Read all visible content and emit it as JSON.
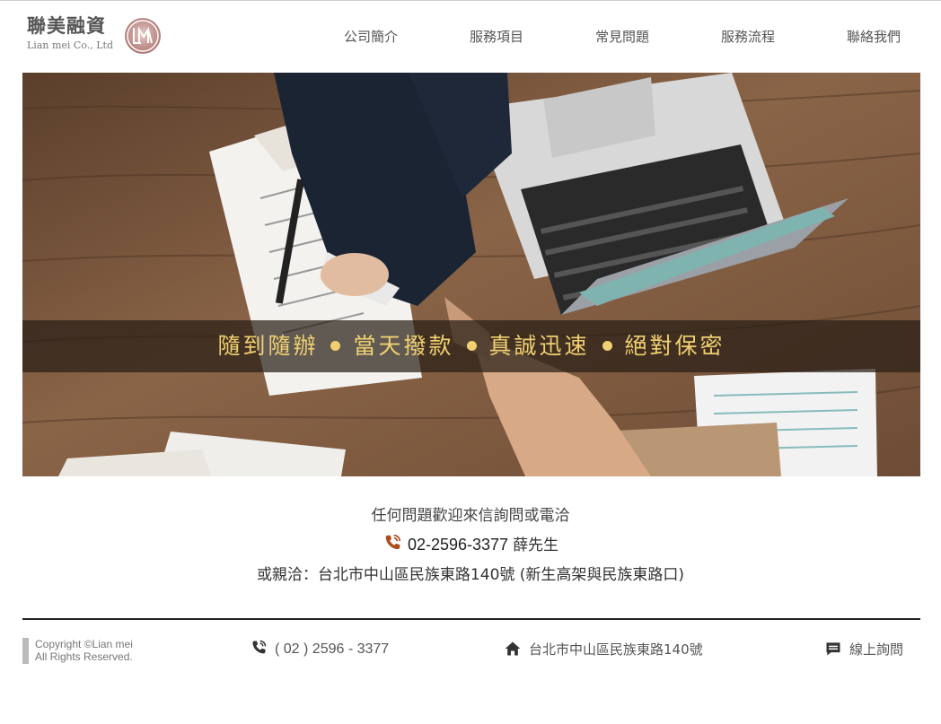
{
  "brand": {
    "name_cn": "聯美融資",
    "name_en": "Lian mei Co., Ltd"
  },
  "nav": {
    "items": [
      {
        "label": "公司簡介"
      },
      {
        "label": "服務項目"
      },
      {
        "label": "常見問題"
      },
      {
        "label": "服務流程"
      },
      {
        "label": "聯絡我們"
      }
    ]
  },
  "hero": {
    "slogans": [
      "隨到隨辦",
      "當天撥款",
      "真誠迅速",
      "絕對保密"
    ],
    "accent_color": "#f0d070"
  },
  "contact": {
    "intro": "任何問題歡迎來信詢問或電洽",
    "phone": "02-2596-3377",
    "contact_person": "薛先生",
    "address_line": "或親洽：台北市中山區民族東路140號 (新生高架與民族東路口)"
  },
  "footer": {
    "copyright_line1": "Copyright ©Lian mei",
    "copyright_line2": "All Rights Reserved.",
    "phone": "( 02 ) 2596 - 3377",
    "address": "台北市中山區民族東路140號",
    "online_inquiry": "線上詢問"
  },
  "icons": {
    "logo": "lm-monogram-icon",
    "phone": "phone-ringing-icon",
    "home": "home-icon",
    "chat": "chat-bubble-icon"
  }
}
